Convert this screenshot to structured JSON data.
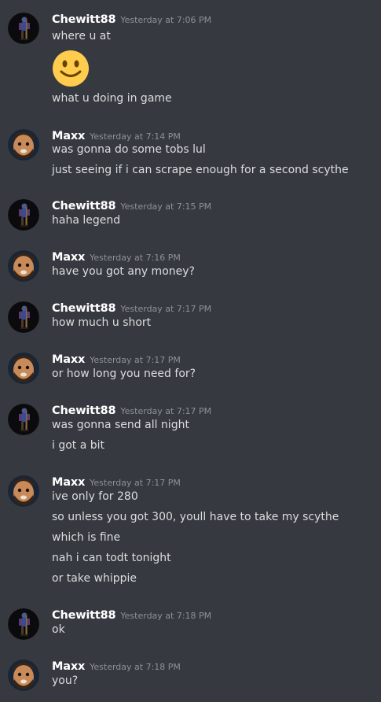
{
  "users": {
    "chewitt": "Chewitt88",
    "maxx": "Maxx"
  },
  "groups": [
    {
      "author": "Chewitt88",
      "time": "Yesterday at 7:06 PM",
      "lines": [
        "where u at",
        "what u doing in game"
      ],
      "emoji": "slightly-smiling-face"
    },
    {
      "author": "Maxx",
      "time": "Yesterday at 7:14 PM",
      "lines": [
        "was gonna do some tobs lul",
        "just seeing if i can scrape enough for a second scythe"
      ]
    },
    {
      "author": "Chewitt88",
      "time": "Yesterday at 7:15 PM",
      "lines": [
        "haha legend"
      ]
    },
    {
      "author": "Maxx",
      "time": "Yesterday at 7:16 PM",
      "lines": [
        "have you got any money?"
      ]
    },
    {
      "author": "Chewitt88",
      "time": "Yesterday at 7:17 PM",
      "lines": [
        "how much u short"
      ]
    },
    {
      "author": "Maxx",
      "time": "Yesterday at 7:17 PM",
      "lines": [
        "or how long you need for?"
      ]
    },
    {
      "author": "Chewitt88",
      "time": "Yesterday at 7:17 PM",
      "lines": [
        "was gonna send all night",
        "i got a bit"
      ]
    },
    {
      "author": "Maxx",
      "time": "Yesterday at 7:17 PM",
      "lines": [
        "ive only for 280",
        "so unless you got 300, youll have to take my scythe",
        "which is fine",
        "nah i can todt tonight",
        "or take whippie"
      ]
    },
    {
      "author": "Chewitt88",
      "time": "Yesterday at 7:18 PM",
      "lines": [
        "ok"
      ]
    },
    {
      "author": "Maxx",
      "time": "Yesterday at 7:18 PM",
      "lines": [
        "you?"
      ]
    }
  ],
  "colors": {
    "background": "#36393f",
    "username": "#ffffff",
    "timestamp": "#8e9297",
    "text": "#dcddde"
  }
}
